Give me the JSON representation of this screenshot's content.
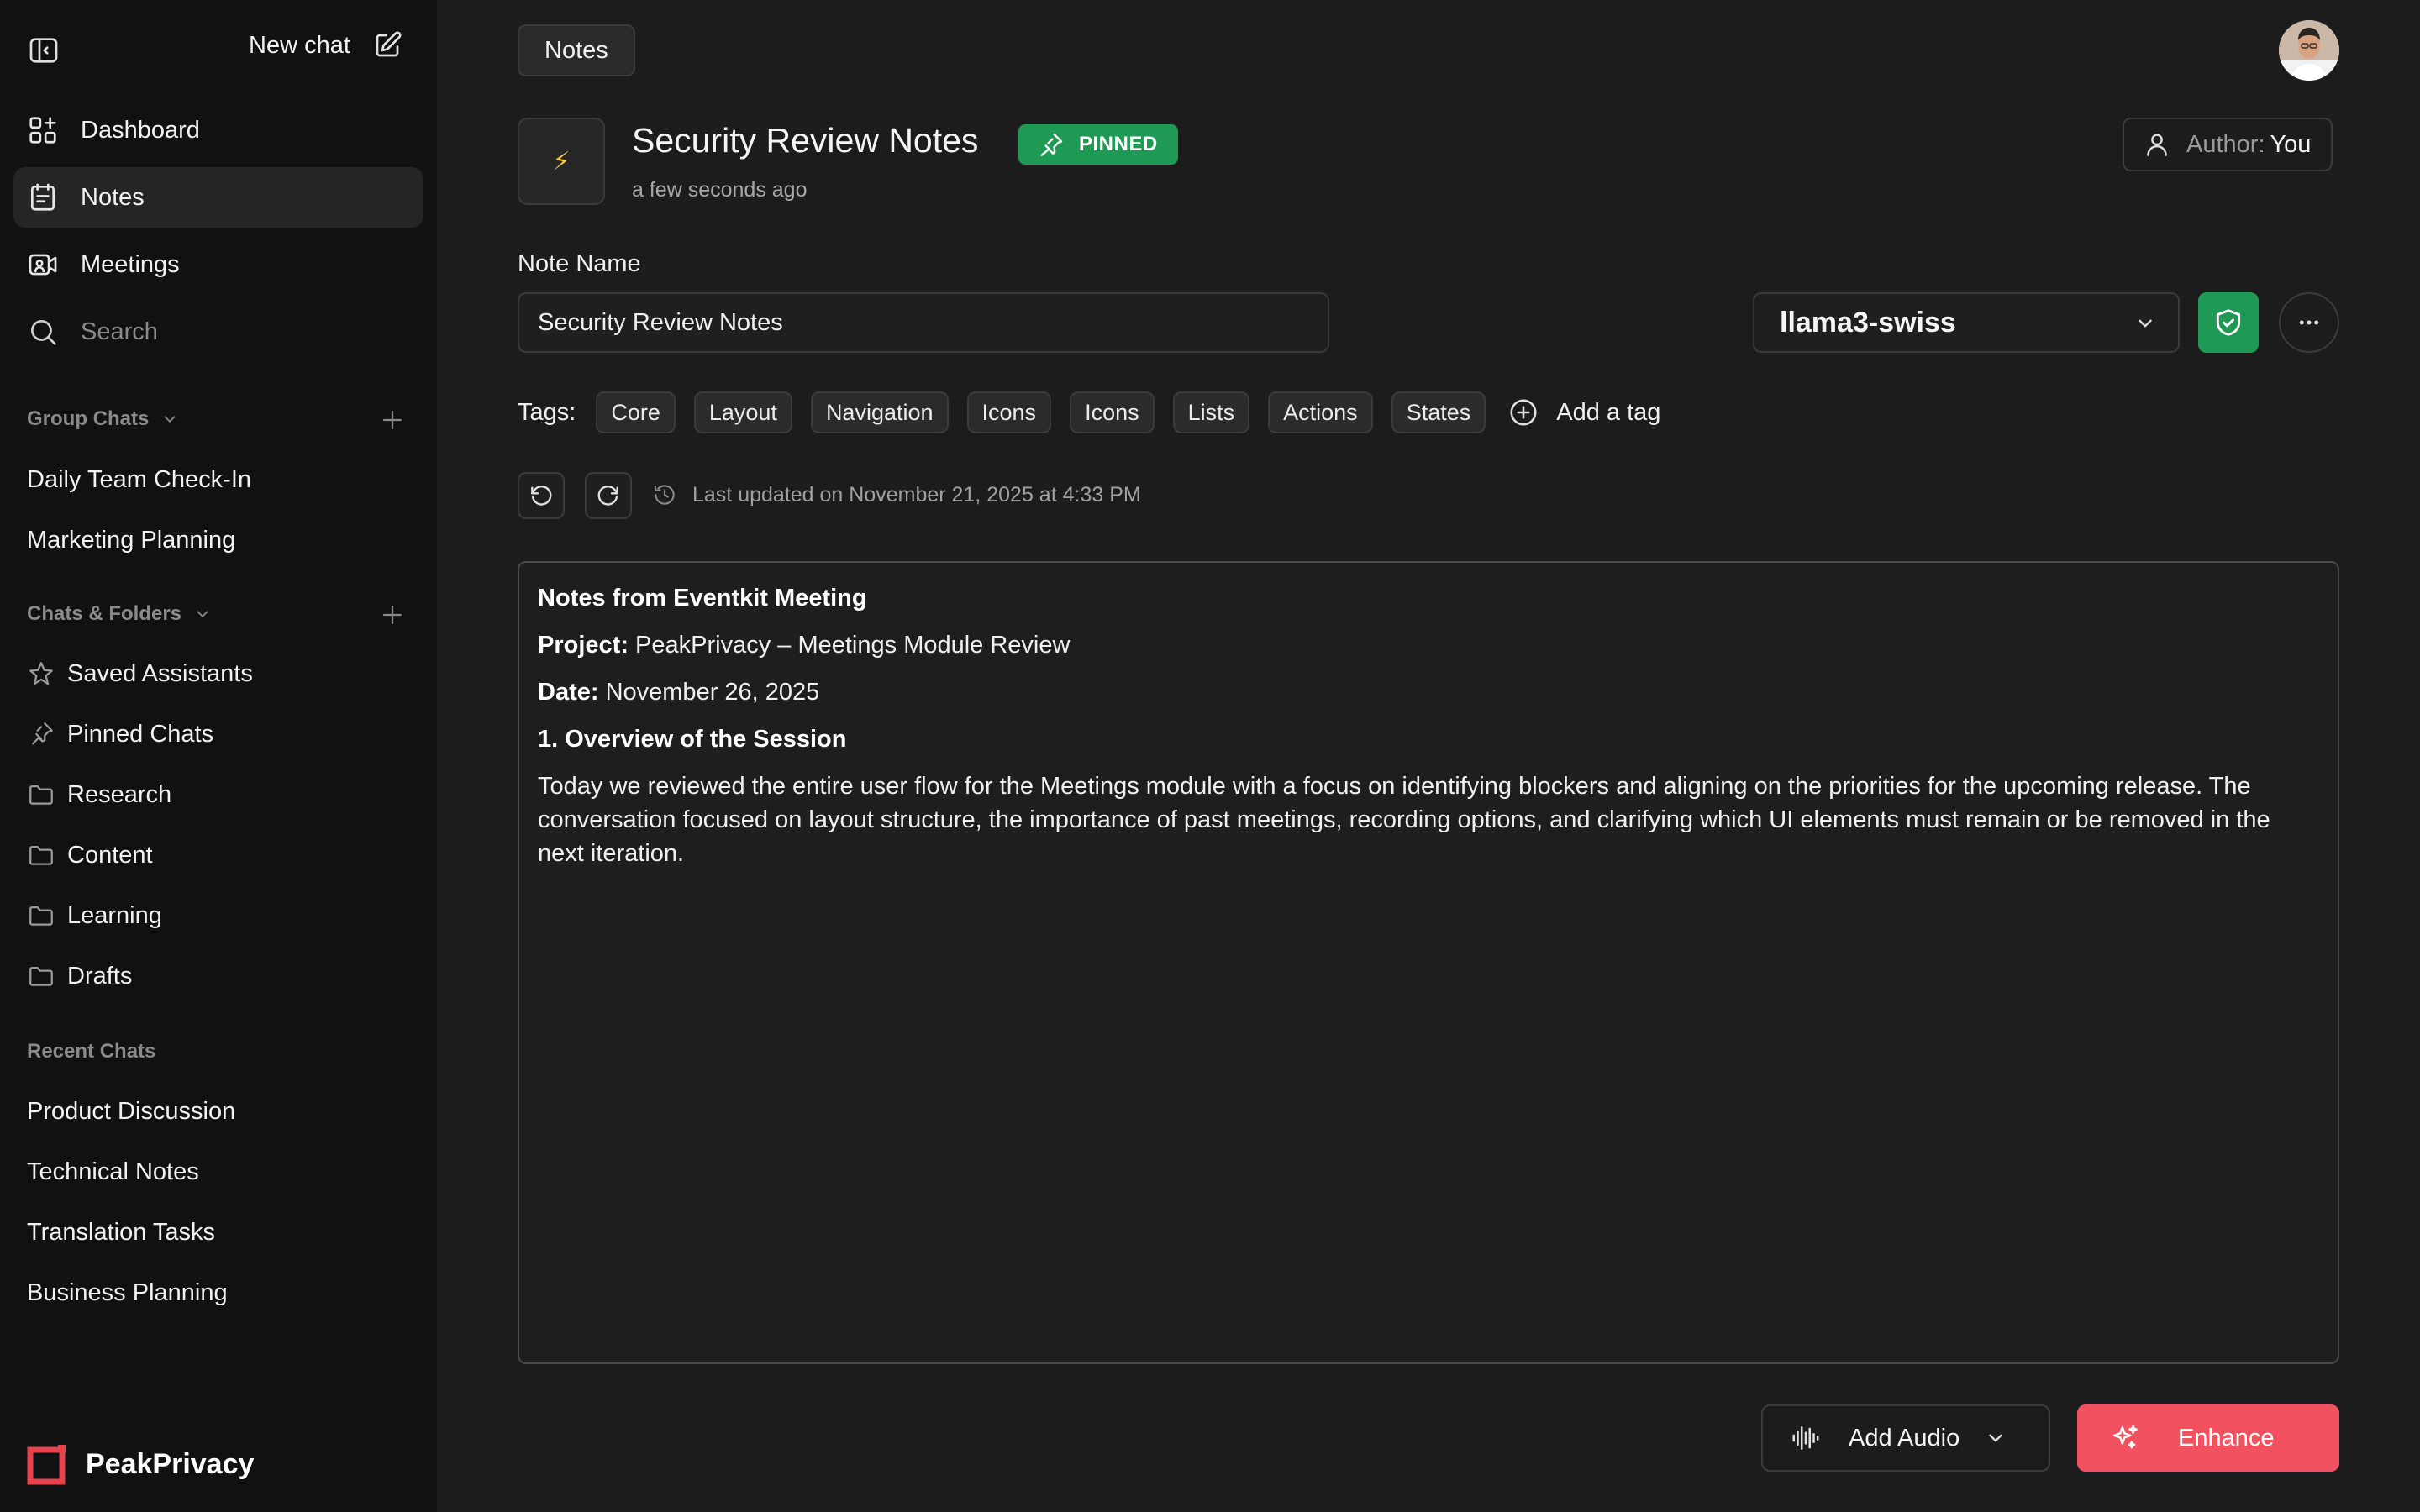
{
  "app": {
    "brand": "PeakPrivacy",
    "accent": "#f2525f",
    "success": "#1f9a55"
  },
  "sidebar": {
    "new_chat": "New chat",
    "nav": [
      {
        "label": "Dashboard",
        "icon": "dashboard-icon"
      },
      {
        "label": "Notes",
        "icon": "notes-icon",
        "active": true
      },
      {
        "label": "Meetings",
        "icon": "meetings-icon"
      },
      {
        "label": "Search",
        "icon": "search-icon"
      }
    ],
    "group_chats": {
      "title": "Group Chats",
      "items": [
        "Daily Team Check-In",
        "Marketing Planning"
      ]
    },
    "chats_folders": {
      "title": "Chats & Folders",
      "items": [
        {
          "label": "Saved Assistants",
          "icon": "star-icon"
        },
        {
          "label": "Pinned Chats",
          "icon": "pin-icon"
        },
        {
          "label": "Research",
          "icon": "folder-icon"
        },
        {
          "label": "Content",
          "icon": "folder-icon"
        },
        {
          "label": "Learning",
          "icon": "folder-icon"
        },
        {
          "label": "Drafts",
          "icon": "folder-icon"
        }
      ]
    },
    "recent_chats": {
      "title": "Recent Chats",
      "items": [
        "Product Discussion",
        "Technical Notes",
        "Translation Tasks",
        "Business Planning"
      ]
    }
  },
  "main": {
    "breadcrumb": "Notes",
    "note_icon": "⚡",
    "title": "Security Review Notes",
    "pinned_label": "PINNED",
    "timestamp": "a few seconds ago",
    "author_key": "Author:",
    "author_value": "You",
    "field_label": "Note Name",
    "note_name_value": "Security Review Notes",
    "model": "llama3-swiss",
    "tags_label": "Tags:",
    "tags": [
      "Core",
      "Layout",
      "Navigation",
      "Icons",
      "Icons",
      "Lists",
      "Actions",
      "States"
    ],
    "add_tag": "Add a tag",
    "last_updated": "Last updated on November 21, 2025 at 4:33 PM",
    "content": {
      "heading": "Notes from Eventkit Meeting",
      "project_key": "Project:",
      "project_value": "PeakPrivacy – Meetings Module Review",
      "date_key": "Date:",
      "date_value": "November 26, 2025",
      "section": "1. Overview of the Session",
      "paragraph": "Today we reviewed the entire user flow for the Meetings module with a focus on identifying blockers and aligning on the priorities for the upcoming release. The conversation focused on layout structure, the importance of past meetings, recording options, and clarifying which UI elements must remain or be removed in the next iteration."
    },
    "add_audio": "Add Audio",
    "enhance": "Enhance"
  }
}
